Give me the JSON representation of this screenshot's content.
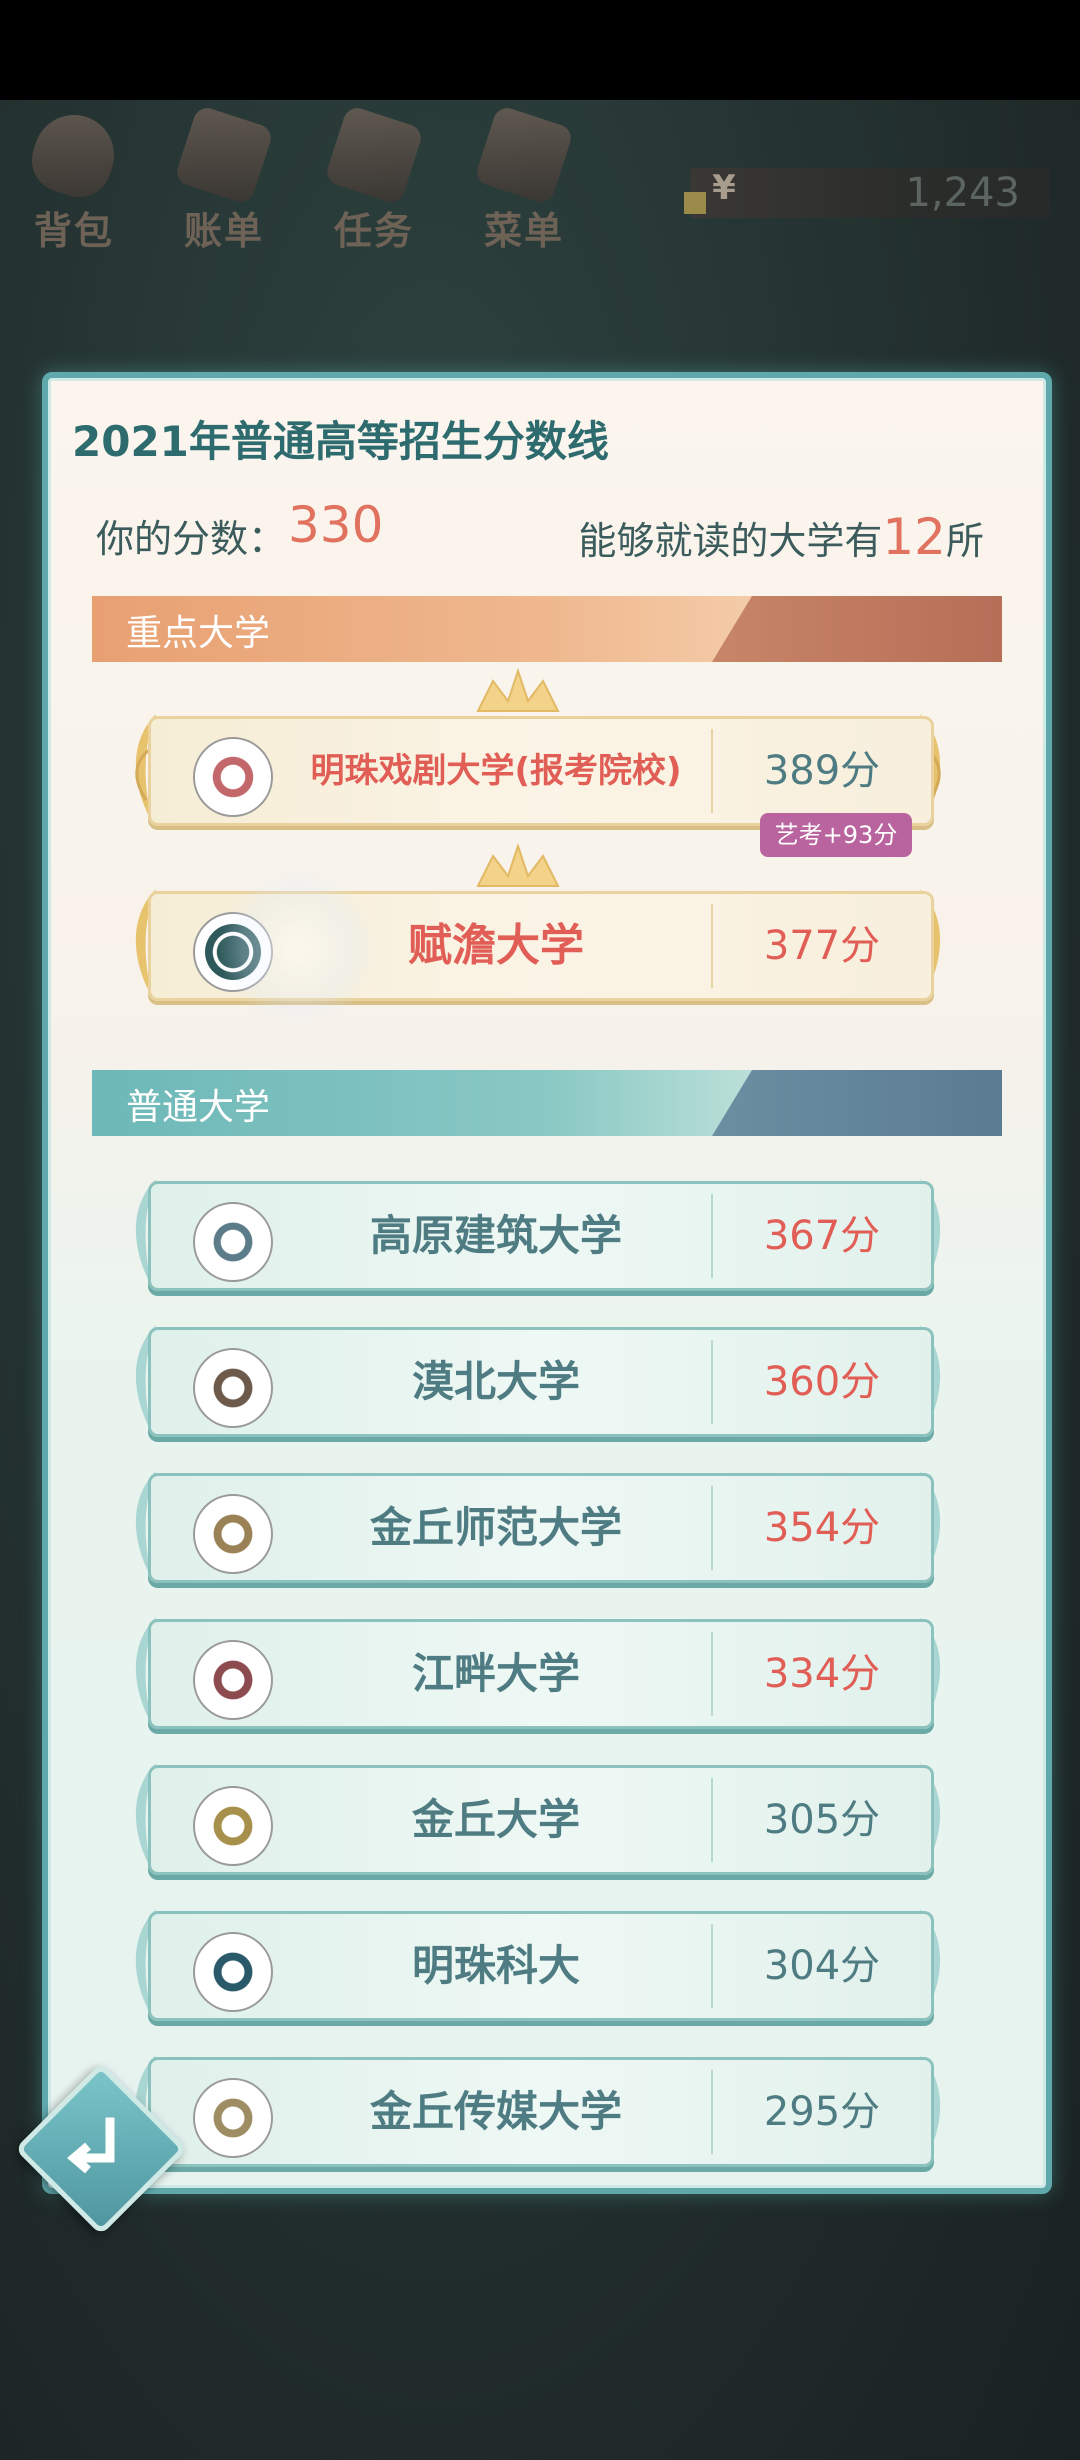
{
  "top_menu": [
    {
      "label": "背包",
      "icon": "bag-icon"
    },
    {
      "label": "账单",
      "icon": "bill-icon"
    },
    {
      "label": "任务",
      "icon": "task-icon"
    },
    {
      "label": "菜单",
      "icon": "menu-icon"
    }
  ],
  "currency": {
    "symbol": "¥",
    "value": "1,243"
  },
  "panel": {
    "title": "2021年普通高等招生分数线",
    "score_label": "你的分数：",
    "score_value": "330",
    "count_prefix": "能够就读的大学有",
    "count_value": "12",
    "count_suffix": "所"
  },
  "sections": {
    "key": "重点大学",
    "normal": "普通大学"
  },
  "key_universities": [
    {
      "name": "明珠戏剧大学(报考院校)",
      "score": "389分",
      "badge": "艺考+93分",
      "score_color": "teal"
    },
    {
      "name": "赋澹大学",
      "score": "377分",
      "score_color": "red"
    }
  ],
  "normal_universities": [
    {
      "name": "高原建筑大学",
      "score": "367分",
      "score_color": "red"
    },
    {
      "name": "漠北大学",
      "score": "360分",
      "score_color": "red"
    },
    {
      "name": "金丘师范大学",
      "score": "354分",
      "score_color": "red"
    },
    {
      "name": "江畔大学",
      "score": "334分",
      "score_color": "red"
    },
    {
      "name": "金丘大学",
      "score": "305分",
      "score_color": "teal"
    },
    {
      "name": "明珠科大",
      "score": "304分",
      "score_color": "teal"
    },
    {
      "name": "金丘传媒大学",
      "score": "295分",
      "score_color": "teal"
    }
  ],
  "colors": {
    "accent_red": "#e15e56",
    "accent_teal": "#4e7c82",
    "panel_border": "#5fa9ad",
    "badge": "#b9649e"
  }
}
